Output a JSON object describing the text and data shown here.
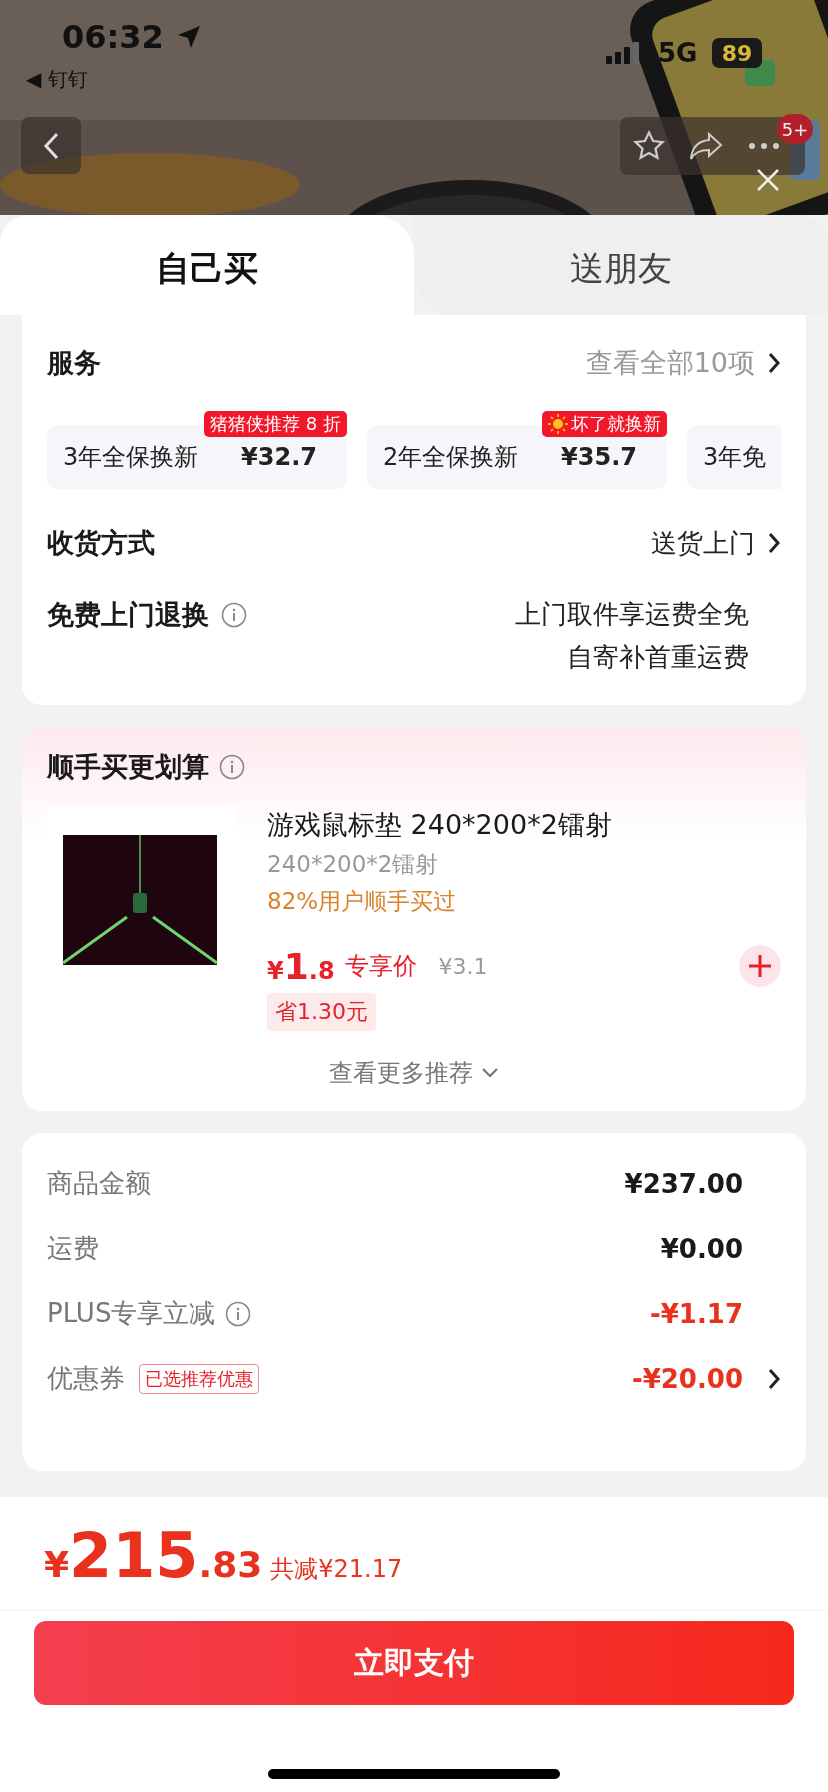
{
  "status_bar": {
    "time": "06:32",
    "back_app": "◀ 钉钉",
    "network": "5G",
    "battery": "89"
  },
  "header": {
    "badge": "5+"
  },
  "tabs": [
    {
      "label": "自己买",
      "selected": true
    },
    {
      "label": "送朋友",
      "selected": false
    }
  ],
  "services": {
    "title": "服务",
    "link": "查看全部10项",
    "options": [
      {
        "name": "3年全保换新",
        "price": "¥32.7",
        "tag": "猪猪侠推荐 8 折",
        "tag_sun": false
      },
      {
        "name": "2年全保换新",
        "price": "¥35.7",
        "tag": "坏了就换新",
        "tag_sun": true
      },
      {
        "name": "3年免"
      }
    ]
  },
  "delivery": {
    "label": "收货方式",
    "value": "送货上门"
  },
  "returns": {
    "label": "免费上门退换",
    "lines": [
      "上门取件享运费全免",
      "自寄补首重运费"
    ]
  },
  "addon": {
    "title": "顺手买更划算",
    "product": {
      "name": "游戏鼠标垫 240*200*2镭射",
      "spec": "240*200*2镭射",
      "note": "82%用户顺手买过",
      "currency": "¥",
      "price_int": "1",
      "price_dec": ".8",
      "price_label": "专享价",
      "original_price": "¥3.1",
      "saving": "省1.30元"
    },
    "more": "查看更多推荐"
  },
  "summary": [
    {
      "kind": "plain",
      "label": "商品金额",
      "value": "¥237.00",
      "discount": false
    },
    {
      "kind": "plain",
      "label": "运费",
      "value": "¥0.00",
      "discount": false
    },
    {
      "kind": "info",
      "label": "PLUS专享立减",
      "value": "-¥1.17",
      "discount": true
    },
    {
      "kind": "coupon",
      "label": "优惠券",
      "tag": "已选推荐优惠",
      "value": "-¥20.00",
      "discount": true
    }
  ],
  "footer": {
    "currency": "¥",
    "price_int": "215",
    "price_dec": ".83",
    "saving": "共减¥21.17",
    "pay_button": "立即支付"
  }
}
